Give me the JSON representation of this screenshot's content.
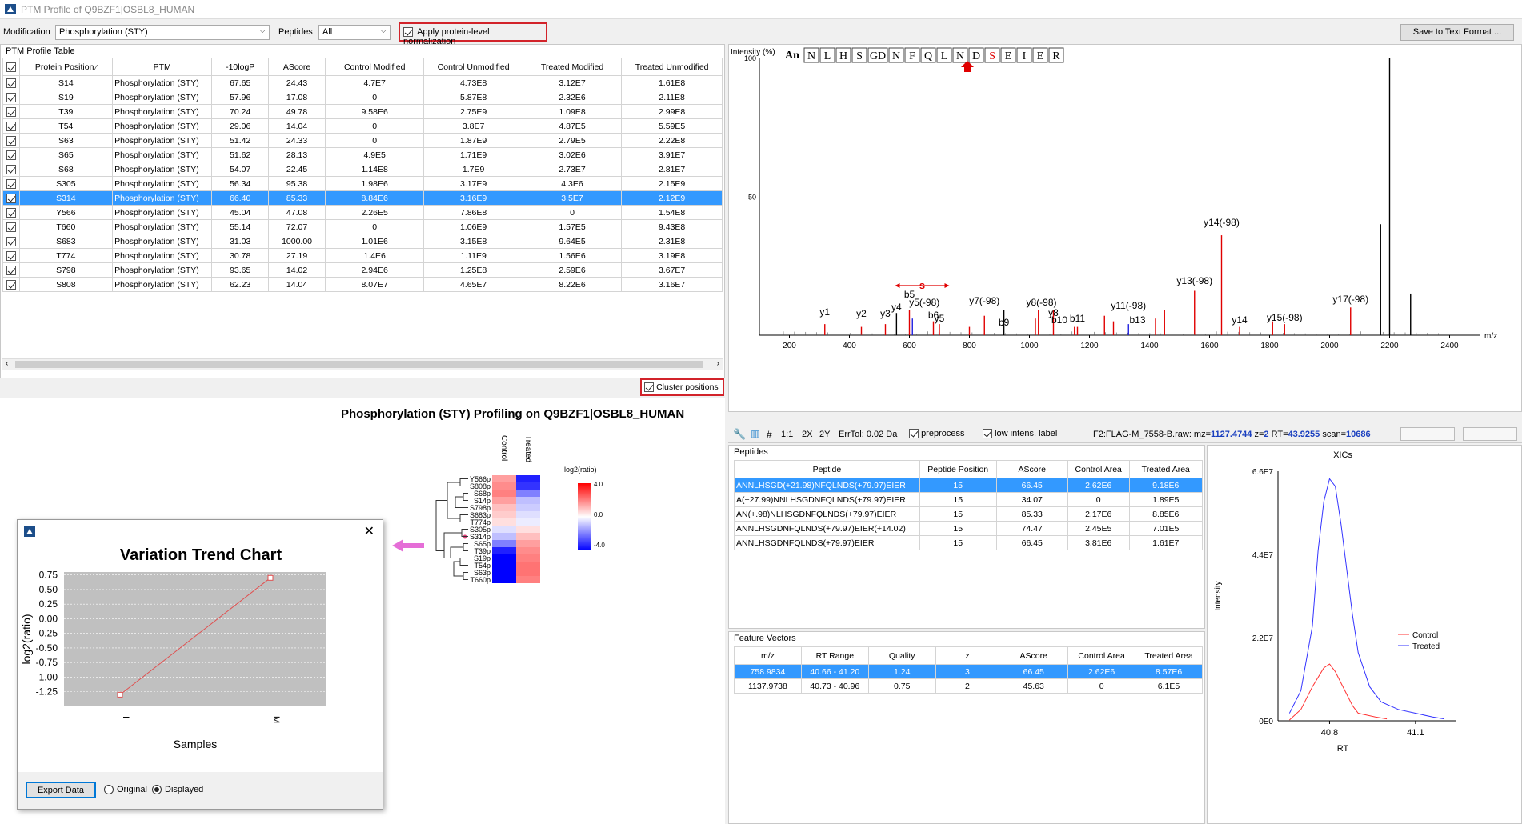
{
  "window": {
    "title": "PTM Profile of Q9BZF1|OSBL8_HUMAN"
  },
  "toolbar": {
    "modification_label": "Modification",
    "modification_value": "Phosphorylation (STY)",
    "peptides_label": "Peptides",
    "peptides_value": "All",
    "normalization_label": "Apply protein-level normalization",
    "normalization_checked": true,
    "save_button": "Save to Text Format ..."
  },
  "ptm_table": {
    "title": "PTM Profile Table",
    "columns": [
      "Protein Position",
      "PTM",
      "-10logP",
      "AScore",
      "Control Modified",
      "Control Unmodified",
      "Treated Modified",
      "Treated Unmodified"
    ],
    "rows": [
      [
        "S14",
        "Phosphorylation (STY)",
        "67.65",
        "24.43",
        "4.7E7",
        "4.73E8",
        "3.12E7",
        "1.61E8"
      ],
      [
        "S19",
        "Phosphorylation (STY)",
        "57.96",
        "17.08",
        "0",
        "5.87E8",
        "2.32E6",
        "2.11E8"
      ],
      [
        "T39",
        "Phosphorylation (STY)",
        "70.24",
        "49.78",
        "9.58E6",
        "2.75E9",
        "1.09E8",
        "2.99E8"
      ],
      [
        "T54",
        "Phosphorylation (STY)",
        "29.06",
        "14.04",
        "0",
        "3.8E7",
        "4.87E5",
        "5.59E5"
      ],
      [
        "S63",
        "Phosphorylation (STY)",
        "51.42",
        "24.33",
        "0",
        "1.87E9",
        "2.79E5",
        "2.22E8"
      ],
      [
        "S65",
        "Phosphorylation (STY)",
        "51.62",
        "28.13",
        "4.9E5",
        "1.71E9",
        "3.02E6",
        "3.91E7"
      ],
      [
        "S68",
        "Phosphorylation (STY)",
        "54.07",
        "22.45",
        "1.14E8",
        "1.7E9",
        "2.73E7",
        "2.81E7"
      ],
      [
        "S305",
        "Phosphorylation (STY)",
        "56.34",
        "95.38",
        "1.98E6",
        "3.17E9",
        "4.3E6",
        "2.15E9"
      ],
      [
        "S314",
        "Phosphorylation (STY)",
        "66.40",
        "85.33",
        "8.84E6",
        "3.16E9",
        "3.5E7",
        "2.12E9"
      ],
      [
        "Y566",
        "Phosphorylation (STY)",
        "45.04",
        "47.08",
        "2.26E5",
        "7.86E8",
        "0",
        "1.54E8"
      ],
      [
        "T660",
        "Phosphorylation (STY)",
        "55.14",
        "72.07",
        "0",
        "1.06E9",
        "1.57E5",
        "9.43E8"
      ],
      [
        "S683",
        "Phosphorylation (STY)",
        "31.03",
        "1000.00",
        "1.01E6",
        "3.15E8",
        "9.64E5",
        "2.31E8"
      ],
      [
        "T774",
        "Phosphorylation (STY)",
        "30.78",
        "27.19",
        "1.4E6",
        "1.11E9",
        "1.56E6",
        "3.19E8"
      ],
      [
        "S798",
        "Phosphorylation (STY)",
        "93.65",
        "14.02",
        "2.94E6",
        "1.25E8",
        "2.59E6",
        "3.67E7"
      ],
      [
        "S808",
        "Phosphorylation (STY)",
        "62.23",
        "14.04",
        "8.07E7",
        "4.65E7",
        "8.22E6",
        "3.16E7"
      ]
    ],
    "selected_index": 8
  },
  "cluster": {
    "label": "Cluster positions",
    "checked": true
  },
  "heatmap": {
    "title": "Phosphorylation (STY) Profiling on Q9BZF1|OSBL8_HUMAN",
    "col_labels": [
      "Control",
      "Treated"
    ],
    "row_labels": [
      "Y566p",
      "S808p",
      "S68p",
      "S14p",
      "S798p",
      "S683p",
      "T774p",
      "S305p",
      "S314p",
      "S65p",
      "T39p",
      "S19p",
      "T54p",
      "S63p",
      "T660p"
    ],
    "legend_title": "log2(ratio)",
    "legend_ticks": [
      "4.0",
      "0.0",
      "-4.0"
    ],
    "values": [
      [
        1.5,
        -3.5
      ],
      [
        1.8,
        -3.2
      ],
      [
        2.0,
        -2.0
      ],
      [
        1.5,
        -1.0
      ],
      [
        1.0,
        -0.8
      ],
      [
        0.8,
        -0.5
      ],
      [
        0.5,
        -0.3
      ],
      [
        -0.5,
        0.5
      ],
      [
        -1.0,
        1.0
      ],
      [
        -2.0,
        1.5
      ],
      [
        -3.5,
        1.8
      ],
      [
        -4,
        2.0
      ],
      [
        -4,
        2.2
      ],
      [
        -4,
        2.2
      ],
      [
        -4,
        2.0
      ]
    ]
  },
  "trend": {
    "title": "Variation Trend Chart",
    "export_button": "Export Data",
    "radio_original": "Original",
    "radio_displayed": "Displayed",
    "radio_selected": "Displayed",
    "chart_data": {
      "type": "line",
      "categories": [
        "I",
        "M"
      ],
      "values": [
        -1.3,
        0.7
      ],
      "xlabel": "Samples",
      "ylabel": "log2(ratio)",
      "ylim": [
        -1.5,
        0.8
      ],
      "yticks": [
        "0.75",
        "0.50",
        "0.25",
        "0.00",
        "-0.25",
        "-0.50",
        "-0.75",
        "-1.00",
        "-1.25"
      ],
      "grid": true
    }
  },
  "spectrum": {
    "ylabel": "Intensity (%)",
    "y_ticks": [
      "100",
      "50"
    ],
    "x_ticks": [
      "200",
      "400",
      "600",
      "800",
      "1000",
      "1200",
      "1400",
      "1600",
      "1800",
      "2000",
      "2200",
      "2400"
    ],
    "x_unit": "m/z",
    "seq_prefix": "An",
    "sequence": [
      "N",
      "L",
      "H",
      "S",
      "GD",
      "N",
      "F",
      "Q",
      "L",
      "N",
      "D",
      "S",
      "E",
      "I",
      "E",
      "R"
    ],
    "mod_label": "s",
    "ion_labels": [
      "y1",
      "y2",
      "y3",
      "y4",
      "b5",
      "y5(-98)",
      "b6",
      "y5",
      "y7(-98)",
      "b9",
      "y8(-98)",
      "y8",
      "b10",
      "b11",
      "y11(-98)",
      "b13",
      "y13(-98)",
      "y14(-98)",
      "y14",
      "y15(-98)",
      "y17(-98)"
    ],
    "chart_data": {
      "type": "bar",
      "x_range": [
        100,
        2500
      ],
      "peaks": [
        [
          318,
          4,
          "red"
        ],
        [
          440,
          3,
          "red"
        ],
        [
          520,
          4,
          "red"
        ],
        [
          557,
          8,
          "black"
        ],
        [
          600,
          9,
          "red"
        ],
        [
          610,
          6,
          "blue"
        ],
        [
          680,
          5,
          "red"
        ],
        [
          700,
          4,
          "red"
        ],
        [
          800,
          3,
          "red"
        ],
        [
          850,
          7,
          "red"
        ],
        [
          915,
          9,
          "black"
        ],
        [
          1020,
          6,
          "red"
        ],
        [
          1030,
          9,
          "red"
        ],
        [
          1080,
          9,
          "red"
        ],
        [
          1150,
          3,
          "red"
        ],
        [
          1160,
          3,
          "red"
        ],
        [
          1250,
          7,
          "red"
        ],
        [
          1280,
          5,
          "red"
        ],
        [
          1330,
          4,
          "blue"
        ],
        [
          1420,
          6,
          "red"
        ],
        [
          1450,
          9,
          "red"
        ],
        [
          1550,
          16,
          "red"
        ],
        [
          1640,
          36,
          "red"
        ],
        [
          1700,
          3,
          "red"
        ],
        [
          1810,
          5,
          "red"
        ],
        [
          1850,
          4,
          "red"
        ],
        [
          2070,
          10,
          "red"
        ],
        [
          2170,
          40,
          "black"
        ],
        [
          2200,
          100,
          "black"
        ],
        [
          2270,
          15,
          "black"
        ]
      ]
    },
    "toolbar": {
      "ratio": "1:1",
      "zoom2x": "2X",
      "zoom2y": "2Y",
      "errtol": "ErrTol: 0.02 Da",
      "preprocess": "preprocess",
      "low_label": "low intens. label",
      "scan_prefix": "F2:FLAG-M_7558-B.raw: mz=",
      "mz": "1127.4744",
      "z_label": "z=",
      "z": "2",
      "rt_label": "RT=",
      "rt": "43.9255",
      "scan_label": "scan=",
      "scan": "10686"
    }
  },
  "peptides": {
    "title": "Peptides",
    "columns": [
      "Peptide",
      "Peptide Position",
      "AScore",
      "Control Area",
      "Treated Area"
    ],
    "rows": [
      [
        "ANNLHSGD(+21.98)NFQLNDS(+79.97)EIER",
        "15",
        "66.45",
        "2.62E6",
        "9.18E6"
      ],
      [
        "A(+27.99)NNLHSGDNFQLNDS(+79.97)EIER",
        "15",
        "34.07",
        "0",
        "1.89E5"
      ],
      [
        "AN(+.98)NLHSGDNFQLNDS(+79.97)EIER",
        "15",
        "85.33",
        "2.17E6",
        "8.85E6"
      ],
      [
        "ANNLHSGDNFQLNDS(+79.97)EIER(+14.02)",
        "15",
        "74.47",
        "2.45E5",
        "7.01E5"
      ],
      [
        "ANNLHSGDNFQLNDS(+79.97)EIER",
        "15",
        "66.45",
        "3.81E6",
        "1.61E7"
      ]
    ],
    "selected_index": 0
  },
  "features": {
    "title": "Feature Vectors",
    "columns": [
      "m/z",
      "RT Range",
      "Quality",
      "z",
      "AScore",
      "Control Area",
      "Treated Area"
    ],
    "rows": [
      [
        "758.9834",
        "40.66 - 41.20",
        "1.24",
        "3",
        "66.45",
        "2.62E6",
        "8.57E6"
      ],
      [
        "1137.9738",
        "40.73 - 40.96",
        "0.75",
        "2",
        "45.63",
        "0",
        "6.1E5"
      ]
    ],
    "selected_index": 0
  },
  "xic": {
    "title": "XICs",
    "ylabel": "Intensity",
    "xlabel": "RT",
    "y_ticks": [
      "6.6E7",
      "4.4E7",
      "2.2E7",
      "0E0"
    ],
    "x_ticks": [
      "40.8",
      "41.1"
    ],
    "legend": [
      "Control",
      "Treated"
    ],
    "chart_data": {
      "type": "line",
      "series": [
        {
          "name": "Control",
          "color": "#ff3333",
          "x": [
            40.66,
            40.7,
            40.74,
            40.78,
            40.8,
            40.82,
            40.84,
            40.86,
            40.88,
            40.9,
            40.93,
            40.96,
            41.0
          ],
          "y": [
            200000.0,
            3000000.0,
            9000000.0,
            14000000.0,
            15000000.0,
            13000000.0,
            10000000.0,
            7000000.0,
            4000000.0,
            2000000.0,
            1500000.0,
            1000000.0,
            500000.0
          ]
        },
        {
          "name": "Treated",
          "color": "#3333ff",
          "x": [
            40.66,
            40.7,
            40.74,
            40.76,
            40.78,
            40.8,
            40.82,
            40.84,
            40.86,
            40.88,
            40.9,
            40.94,
            40.98,
            41.04,
            41.1,
            41.16,
            41.2
          ],
          "y": [
            2000000.0,
            8000000.0,
            25000000.0,
            45000000.0,
            58000000.0,
            64000000.0,
            62000000.0,
            52000000.0,
            40000000.0,
            28000000.0,
            18000000.0,
            9000000.0,
            5000000.0,
            3000000.0,
            2000000.0,
            1000000.0,
            500000.0
          ]
        }
      ]
    }
  }
}
